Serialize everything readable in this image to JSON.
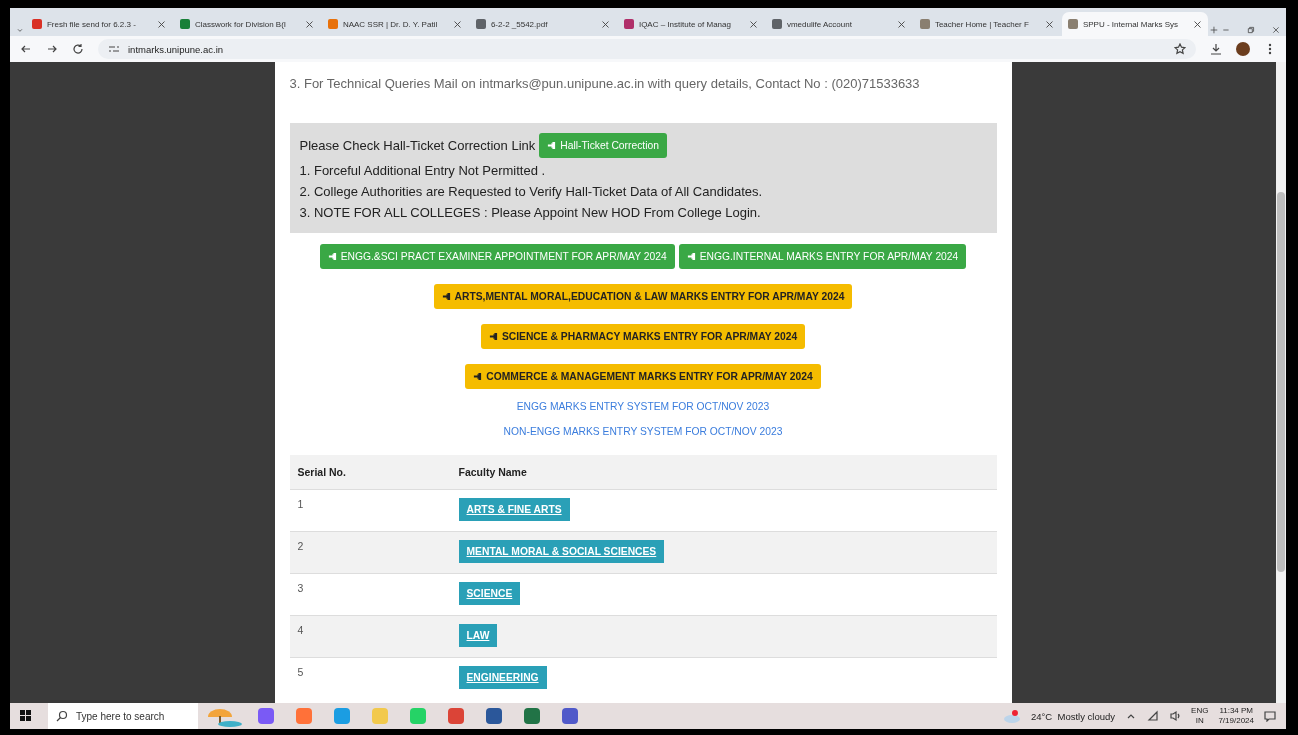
{
  "browser": {
    "tabs": [
      {
        "title": "Fresh file send for 6.2.3 -",
        "selected": false,
        "color": "#d93025"
      },
      {
        "title": "Classwork for Division B(I",
        "selected": false,
        "color": "#188038"
      },
      {
        "title": "NAAC SSR | Dr. D. Y. Patil",
        "selected": false,
        "color": "#e8710a"
      },
      {
        "title": "6-2-2 _5542.pdf",
        "selected": false,
        "color": "#5f6368"
      },
      {
        "title": "IQAC – Institute of Manag",
        "selected": false,
        "color": "#b0306a"
      },
      {
        "title": "vmedulife Account",
        "selected": false,
        "color": "#5f6368"
      },
      {
        "title": "Teacher Home | Teacher F",
        "selected": false,
        "color": "#8a7f70"
      },
      {
        "title": "SPPU - Internal Marks Sys",
        "selected": true,
        "color": "#8a7f70"
      }
    ],
    "url": "intmarks.unipune.ac.in"
  },
  "page": {
    "contact_line": "3. For Technical Queries Mail on intmarks@pun.unipune.ac.in with query details, Contact No : (020)71533633",
    "notice": {
      "lead": "Please Check Hall-Ticket Correction Link",
      "button": "Hall-Ticket Correction",
      "items": [
        "1. Forceful Additional Entry Not Permitted .",
        "2. College Authorities are Requested to Verify Hall-Ticket Data of All Candidates.",
        "3. NOTE FOR ALL COLLEGES : Please Appoint New HOD From College Login."
      ]
    },
    "button_rows": [
      [
        {
          "label": "ENGG.&SCI PRACT EXAMINER APPOINTMENT FOR APR/MAY 2024",
          "kind": "success"
        },
        {
          "label": "ENGG.INTERNAL MARKS ENTRY FOR APR/MAY 2024",
          "kind": "success"
        }
      ],
      [
        {
          "label": "ARTS,MENTAL MORAL,EDUCATION & LAW MARKS ENTRY FOR APR/MAY 2024",
          "kind": "warning"
        }
      ],
      [
        {
          "label": "SCIENCE & PHARMACY MARKS ENTRY FOR APR/MAY 2024",
          "kind": "warning"
        }
      ],
      [
        {
          "label": "COMMERCE & MANAGEMENT MARKS ENTRY FOR APR/MAY 2024",
          "kind": "warning"
        }
      ]
    ],
    "links": [
      "ENGG MARKS ENTRY SYSTEM FOR OCT/NOV 2023",
      "NON-ENGG MARKS ENTRY SYSTEM FOR OCT/NOV 2023"
    ],
    "table": {
      "columns": [
        "Serial No.",
        "Faculty Name"
      ],
      "rows": [
        {
          "serial": "1",
          "faculty": "ARTS & FINE ARTS"
        },
        {
          "serial": "2",
          "faculty": "MENTAL MORAL & SOCIAL SCIENCES"
        },
        {
          "serial": "3",
          "faculty": "SCIENCE"
        },
        {
          "serial": "4",
          "faculty": "LAW"
        },
        {
          "serial": "5",
          "faculty": "ENGINEERING"
        }
      ]
    }
  },
  "taskbar": {
    "search_placeholder": "Type here to search",
    "apps": [
      {
        "color": "#7a5af5"
      },
      {
        "color": "#ff7139"
      },
      {
        "color": "#1b9de2"
      },
      {
        "color": "#f2c94c"
      },
      {
        "color": "#25d366"
      },
      {
        "color": "#db4437"
      },
      {
        "color": "#2b579a"
      },
      {
        "color": "#217346"
      },
      {
        "color": "#5059c9"
      }
    ],
    "weather": "24°C  Mostly cloudy",
    "lang": "ENG",
    "region": "IN",
    "time": "11:34 PM",
    "date": "7/19/2024"
  }
}
